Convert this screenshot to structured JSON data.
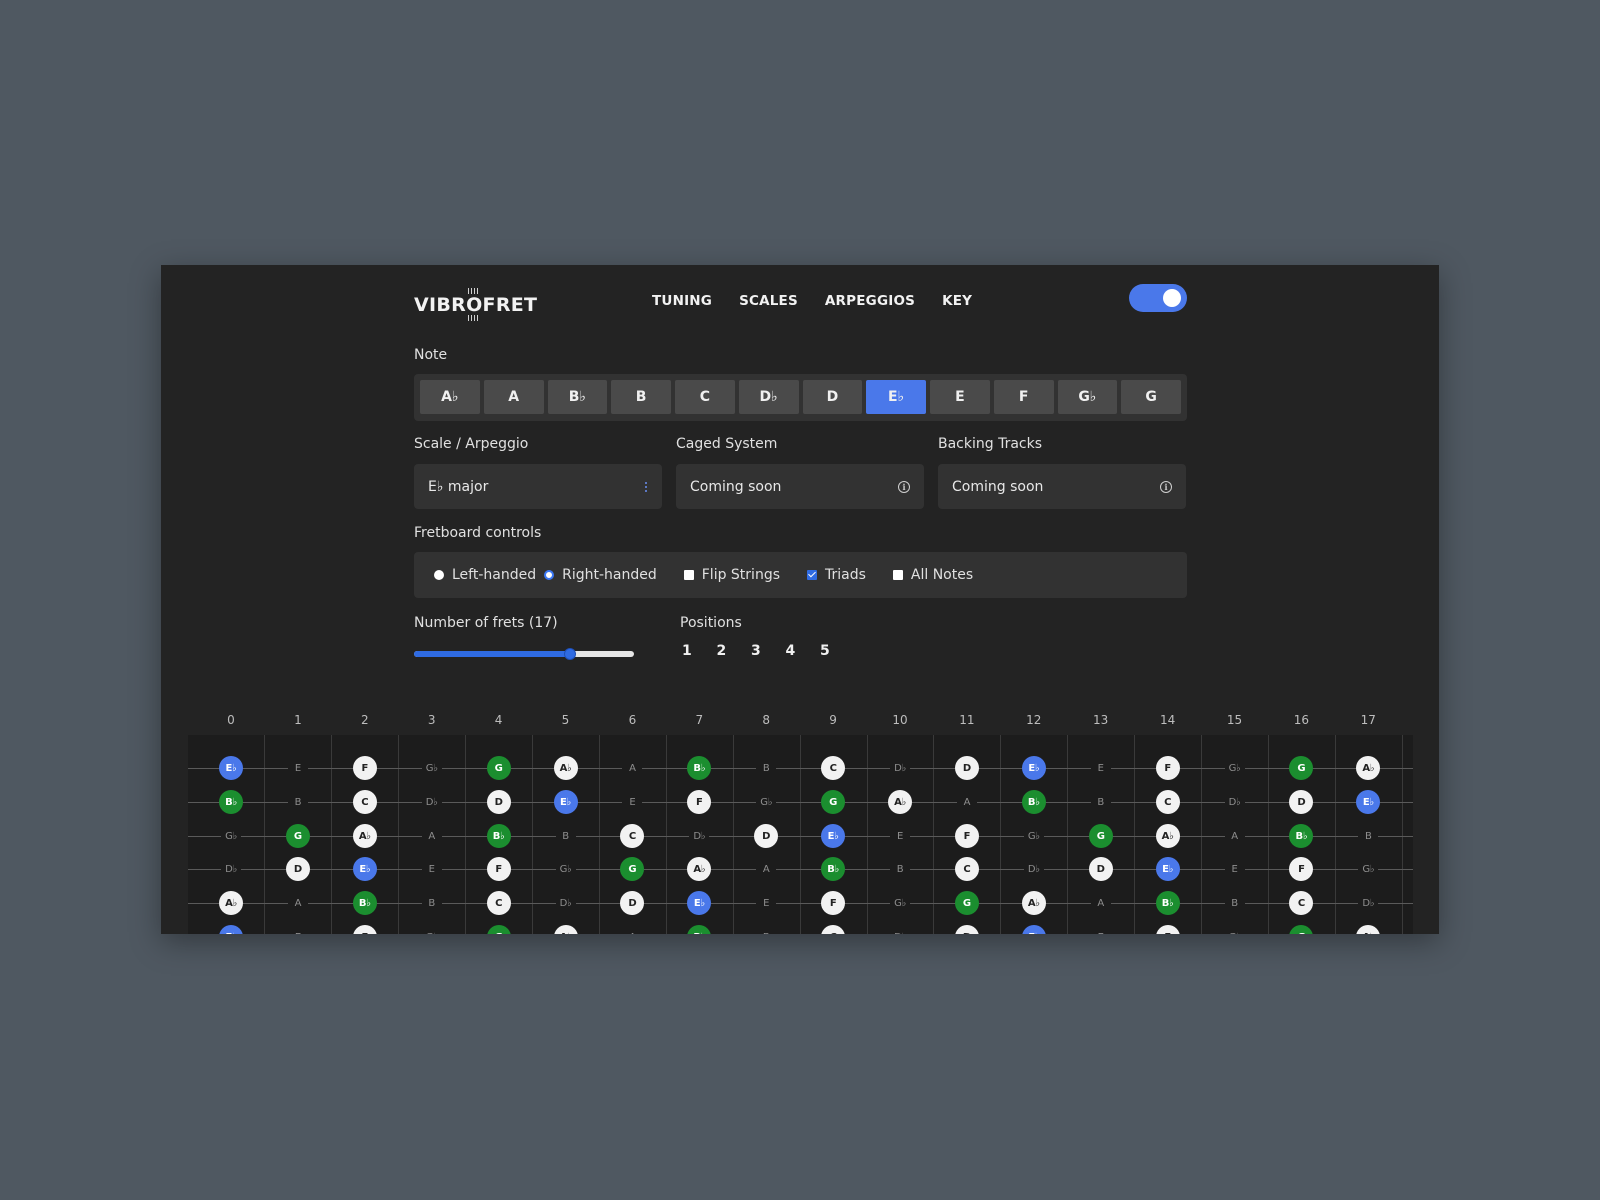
{
  "header": {
    "logo": "VIBROFRET",
    "nav": [
      "TUNING",
      "SCALES",
      "ARPEGGIOS",
      "KEY"
    ],
    "theme_toggle_on": true
  },
  "note_section": {
    "label": "Note",
    "notes": [
      "A♭",
      "A",
      "B♭",
      "B",
      "C",
      "D♭",
      "D",
      "E♭",
      "E",
      "F",
      "G♭",
      "G"
    ],
    "selected": "E♭"
  },
  "scale": {
    "label": "Scale / Arpeggio",
    "value": "E♭ major"
  },
  "caged": {
    "label": "Caged System",
    "value": "Coming soon"
  },
  "backing": {
    "label": "Backing Tracks",
    "value": "Coming soon"
  },
  "fretboard_controls": {
    "label": "Fretboard controls",
    "left_handed": "Left-handed",
    "right_handed": "Right-handed",
    "flip_strings": "Flip Strings",
    "triads": "Triads",
    "all_notes": "All Notes",
    "handedness": "right",
    "flip_strings_checked": false,
    "triads_checked": true,
    "all_notes_checked": false
  },
  "frets": {
    "label": "Number of frets (17)",
    "value": 17,
    "min": 0,
    "max": 24
  },
  "positions": {
    "label": "Positions",
    "items": [
      "1",
      "2",
      "3",
      "4",
      "5"
    ]
  },
  "fret_numbers": [
    "0",
    "1",
    "2",
    "3",
    "4",
    "5",
    "6",
    "7",
    "8",
    "9",
    "10",
    "11",
    "12",
    "13",
    "14",
    "15",
    "16",
    "17"
  ],
  "strings": [
    [
      "E♭",
      "E",
      "F",
      "G♭",
      "G",
      "A♭",
      "A",
      "B♭",
      "B",
      "C",
      "D♭",
      "D",
      "E♭",
      "E",
      "F",
      "G♭",
      "G",
      "A♭"
    ],
    [
      "B♭",
      "B",
      "C",
      "D♭",
      "D",
      "E♭",
      "E",
      "F",
      "G♭",
      "G",
      "A♭",
      "A",
      "B♭",
      "B",
      "C",
      "D♭",
      "D",
      "E♭"
    ],
    [
      "G♭",
      "G",
      "A♭",
      "A",
      "B♭",
      "B",
      "C",
      "D♭",
      "D",
      "E♭",
      "E",
      "F",
      "G♭",
      "G",
      "A♭",
      "A",
      "B♭",
      "B"
    ],
    [
      "D♭",
      "D",
      "E♭",
      "E",
      "F",
      "G♭",
      "G",
      "A♭",
      "A",
      "B♭",
      "B",
      "C",
      "D♭",
      "D",
      "E♭",
      "E",
      "F",
      "G♭"
    ],
    [
      "A♭",
      "A",
      "B♭",
      "B",
      "C",
      "D♭",
      "D",
      "E♭",
      "E",
      "F",
      "G♭",
      "G",
      "A♭",
      "A",
      "B♭",
      "B",
      "C",
      "D♭"
    ],
    [
      "E♭",
      "E",
      "F",
      "G♭",
      "G",
      "A♭",
      "A",
      "B♭",
      "B",
      "C",
      "D♭",
      "D",
      "E♭",
      "E",
      "F",
      "G♭",
      "G",
      "A♭"
    ]
  ],
  "note_styles": {
    "E♭": "blue",
    "G": "green",
    "B♭": "green",
    "F": "white",
    "A♭": "white",
    "C": "white",
    "D": "white"
  },
  "colors": {
    "accent": "#4a78ea",
    "triad_green": "#1b8e2f",
    "scale_white": "#f2f2f2"
  }
}
